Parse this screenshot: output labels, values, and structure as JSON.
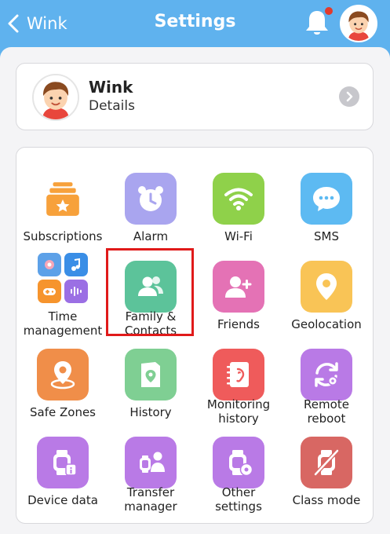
{
  "header": {
    "back_label": "Wink",
    "title": "Settings",
    "colors": {
      "bar": "#5fb2ee",
      "notification_dot": "#e23a2c"
    }
  },
  "profile": {
    "name": "Wink",
    "subtitle": "Details"
  },
  "grid": {
    "highlight_color": "#e01a1a",
    "tiles": [
      {
        "label": "Subscriptions",
        "icon": "subscriptions-icon",
        "color": "#f7a13b"
      },
      {
        "label": "Alarm",
        "icon": "alarm-clock-icon",
        "color": "#a9a5ef"
      },
      {
        "label": "Wi-Fi",
        "icon": "wifi-icon",
        "color": "#8fd14a"
      },
      {
        "label": "SMS",
        "icon": "sms-bubble-icon",
        "color": "#5dbaf2"
      },
      {
        "label": "Time\nmanagement",
        "icon": "time-management-icon",
        "color": "#ffffff"
      },
      {
        "label": "Family &\nContacts",
        "icon": "family-contacts-icon",
        "color": "#5cc39a"
      },
      {
        "label": "Friends",
        "icon": "add-friend-icon",
        "color": "#e472b5"
      },
      {
        "label": "Geolocation",
        "icon": "location-pin-icon",
        "color": "#f9c456"
      },
      {
        "label": "Safe Zones",
        "icon": "safe-zone-icon",
        "color": "#f08e49"
      },
      {
        "label": "History",
        "icon": "history-icon",
        "color": "#7fcf93"
      },
      {
        "label": "Monitoring\nhistory",
        "icon": "monitoring-history-icon",
        "color": "#ef5b5b"
      },
      {
        "label": "Remote\nreboot",
        "icon": "remote-reboot-icon",
        "color": "#b97ae6"
      },
      {
        "label": "Device data",
        "icon": "device-data-icon",
        "color": "#b97ae6"
      },
      {
        "label": "Transfer\nmanager",
        "icon": "transfer-manager-icon",
        "color": "#b97ae6"
      },
      {
        "label": "Other\nsettings",
        "icon": "other-settings-icon",
        "color": "#b97ae6"
      },
      {
        "label": "Class mode",
        "icon": "class-mode-icon",
        "color": "#d86763"
      }
    ]
  }
}
